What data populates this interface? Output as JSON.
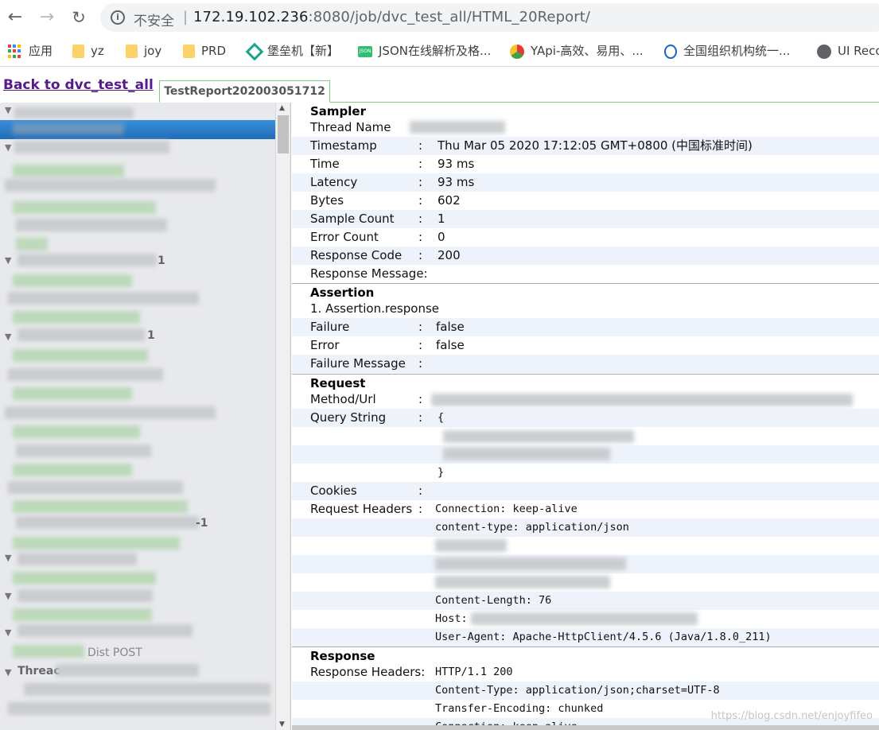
{
  "browser": {
    "security_label": "不安全",
    "url_host": "172.19.102.236",
    "url_rest": ":8080/job/dvc_test_all/HTML_20Report/",
    "bookmarks": [
      {
        "label": "应用",
        "icon": "apps-grid-icon"
      },
      {
        "label": "yz",
        "icon": "folder-icon"
      },
      {
        "label": "joy",
        "icon": "folder-icon"
      },
      {
        "label": "PRD",
        "icon": "folder-icon"
      },
      {
        "label": "堡垒机【新】",
        "icon": "bastion-icon"
      },
      {
        "label": "JSON在线解析及格...",
        "icon": "json-icon"
      },
      {
        "label": "YApi-高效、易用、...",
        "icon": "yapi-icon"
      },
      {
        "label": "全国组织机构统一...",
        "icon": "org-icon"
      },
      {
        "label": "UI Reco",
        "icon": "globe-icon"
      }
    ]
  },
  "page": {
    "back_link": "Back to dvc_test_all",
    "report_tab": "TestReport202003051712"
  },
  "tree": {
    "visible_texts": [
      "1",
      "1",
      "-1",
      "Dist POST",
      "Threac"
    ]
  },
  "detail": {
    "sampler": {
      "heading": "Sampler",
      "rows": [
        {
          "key": "Thread Name",
          "value": ""
        },
        {
          "key": "Timestamp",
          "value": "Thu Mar 05 2020 17:12:05 GMT+0800 (中国标准时间)"
        },
        {
          "key": "Time",
          "value": "93 ms"
        },
        {
          "key": "Latency",
          "value": "93 ms"
        },
        {
          "key": "Bytes",
          "value": "602"
        },
        {
          "key": "Sample Count",
          "value": "1"
        },
        {
          "key": "Error Count",
          "value": "0"
        },
        {
          "key": "Response Code",
          "value": "200"
        },
        {
          "key": "Response Message:",
          "value": ""
        }
      ]
    },
    "assertion": {
      "heading": "Assertion",
      "title": "1. Assertion.response",
      "rows": [
        {
          "key": "Failure",
          "value": "false"
        },
        {
          "key": "Error",
          "value": "false"
        },
        {
          "key": "Failure Message",
          "value": ""
        }
      ]
    },
    "request": {
      "heading": "Request",
      "method_url_key": "Method/Url",
      "query_string_key": "Query String",
      "query_open": "{",
      "query_close": "}",
      "cookies_key": "Cookies",
      "headers_key": "Request Headers",
      "headers": [
        "Connection: keep-alive",
        "content-type: application/json",
        "Content-Length: 76",
        "Host:",
        "User-Agent: Apache-HttpClient/4.5.6 (Java/1.8.0_211)"
      ]
    },
    "response": {
      "heading": "Response",
      "headers_key": "Response Headers:",
      "headers": [
        "HTTP/1.1 200",
        "Content-Type: application/json;charset=UTF-8",
        "Transfer-Encoding: chunked",
        "Connection: keep-alive"
      ]
    },
    "colon": ":"
  },
  "watermark": "https://blog.csdn.net/enjoyfifeo"
}
